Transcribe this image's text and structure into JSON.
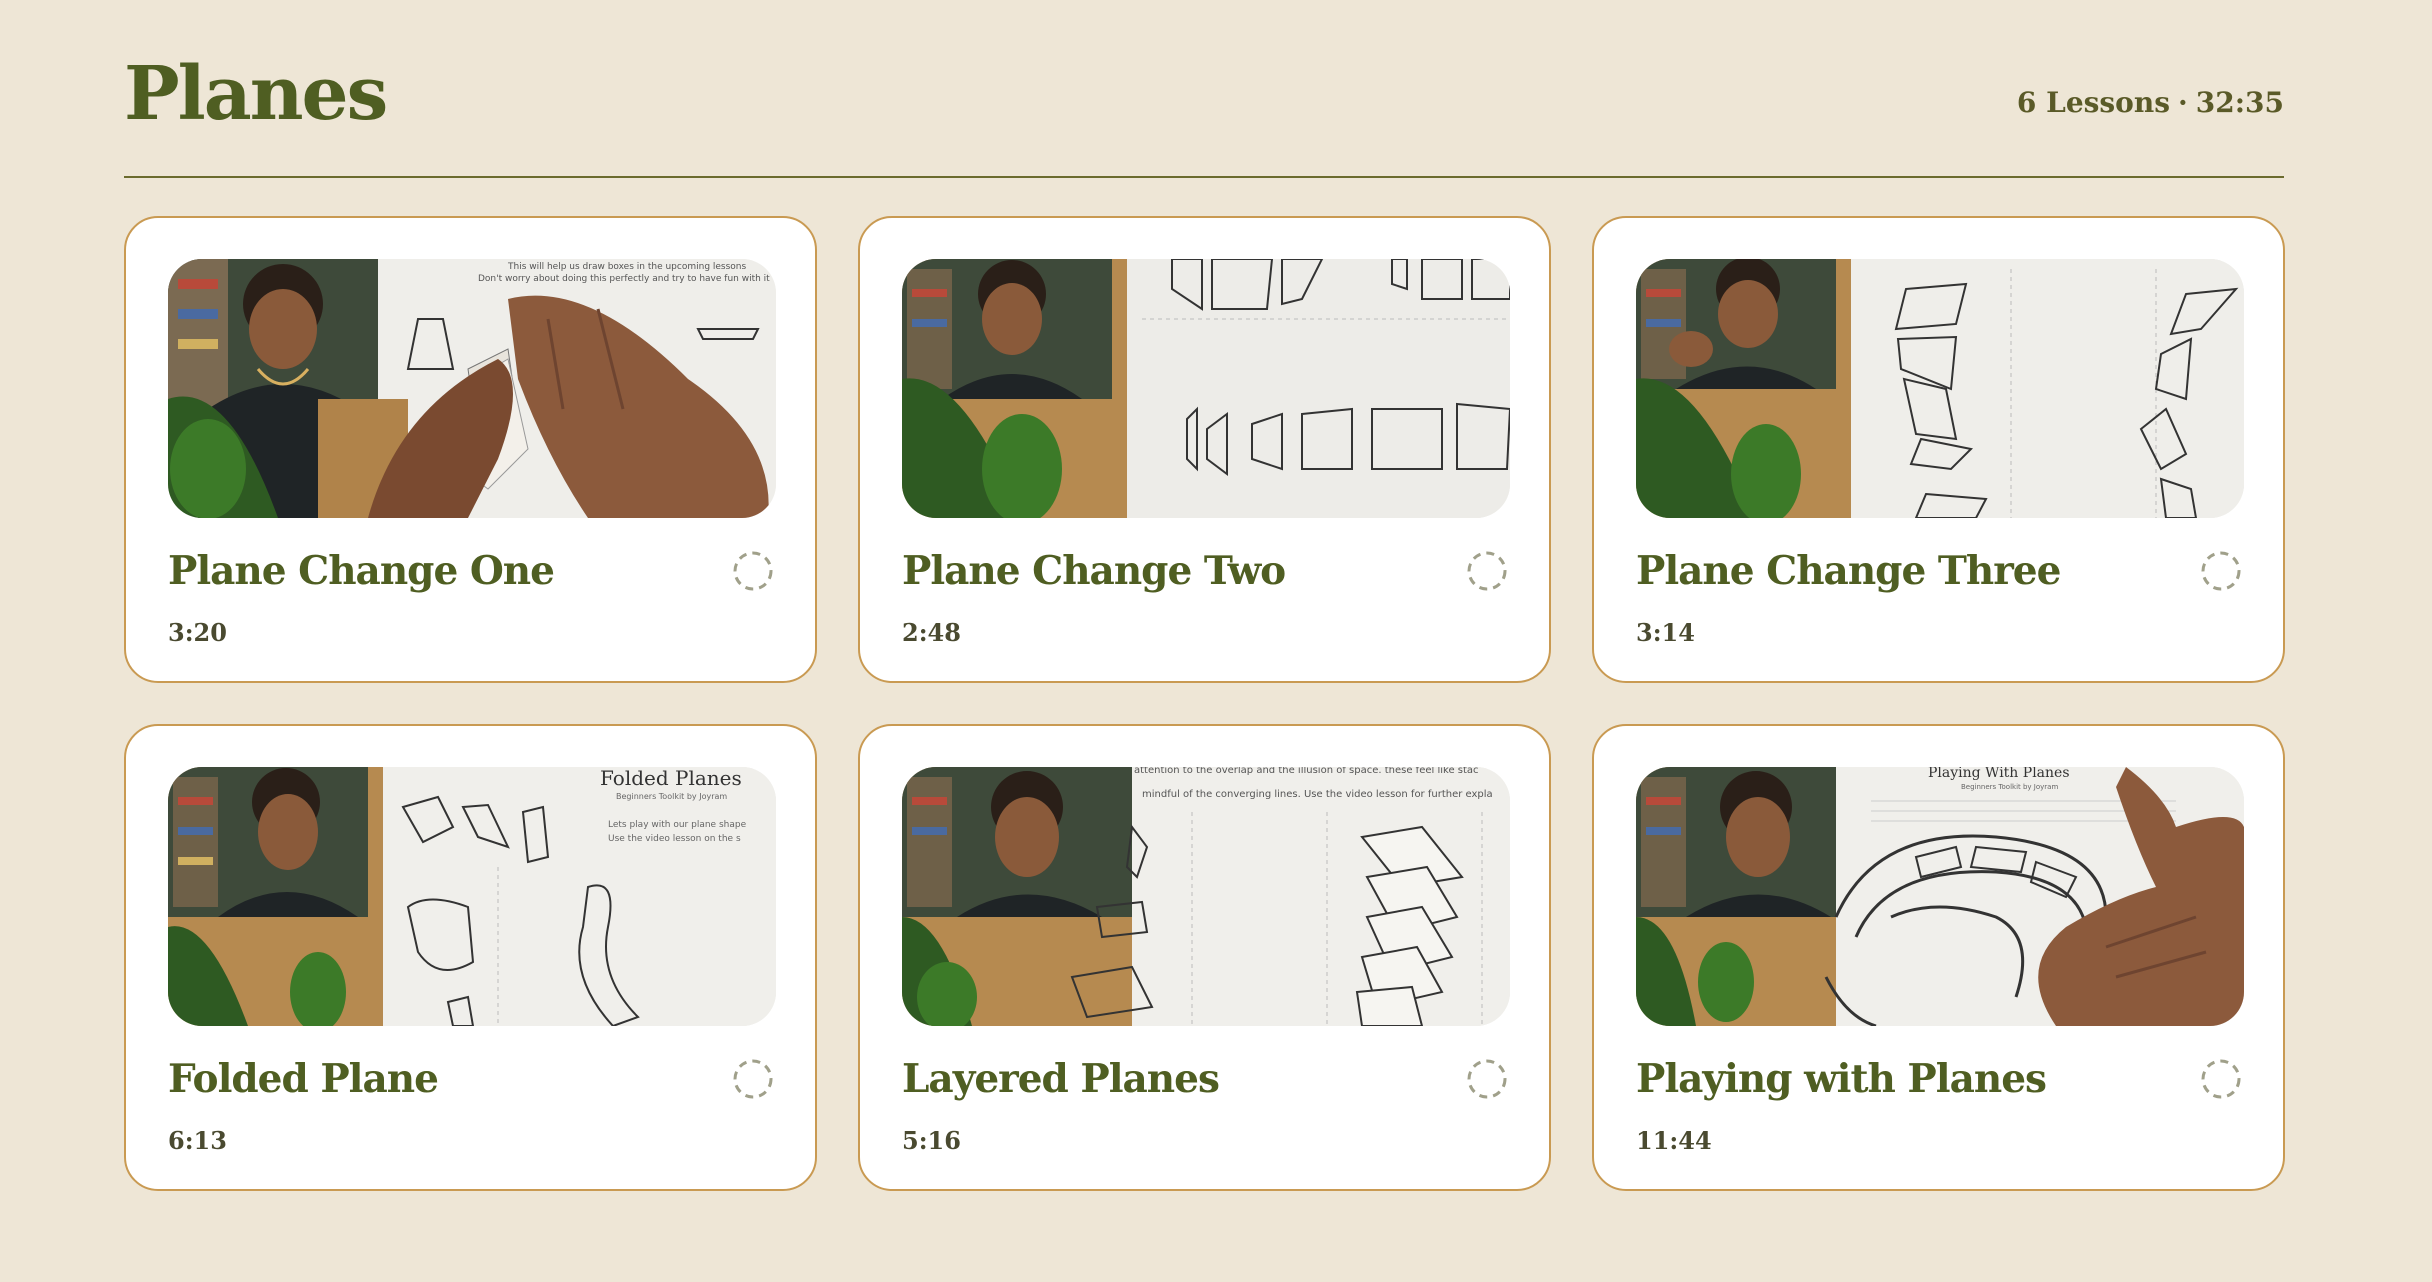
{
  "header": {
    "title": "Planes",
    "lesson_count": "6 Lessons",
    "separator": "·",
    "total_duration": "32:35"
  },
  "lessons": [
    {
      "title": "Plane Change One",
      "duration": "3:20",
      "status_icon": "progress-ring-icon"
    },
    {
      "title": "Plane Change Two",
      "duration": "2:48",
      "status_icon": "progress-ring-icon"
    },
    {
      "title": "Plane Change Three",
      "duration": "3:14",
      "status_icon": "progress-ring-icon"
    },
    {
      "title": "Folded Plane",
      "duration": "6:13",
      "status_icon": "progress-ring-icon"
    },
    {
      "title": "Layered Planes",
      "duration": "5:16",
      "status_icon": "progress-ring-icon"
    },
    {
      "title": "Playing with Planes",
      "duration": "11:44",
      "status_icon": "progress-ring-icon"
    }
  ],
  "thumbnail_text": {
    "folded": {
      "heading": "Folded Planes",
      "subheading": "Beginners Toolkit by Joyram",
      "line1": "Lets play with our plane shape",
      "line2": "Use the video lesson on the s"
    },
    "layered": {
      "line1": "attention to the overlap and the illusion of space. these feel like stac",
      "line2": "mindful of the converging lines. Use the video lesson for further expla"
    },
    "playing": {
      "heading": "Playing With Planes",
      "subheading": "Beginners Toolkit by Joyram"
    },
    "one": {
      "line1": "This will help us draw boxes in the upcoming lessons",
      "line2": "Don't worry about doing this perfectly and try to have fun with it"
    }
  },
  "colors": {
    "background": "#EEE6D6",
    "accent_green": "#4F5E22",
    "card_border": "#C99A52"
  }
}
